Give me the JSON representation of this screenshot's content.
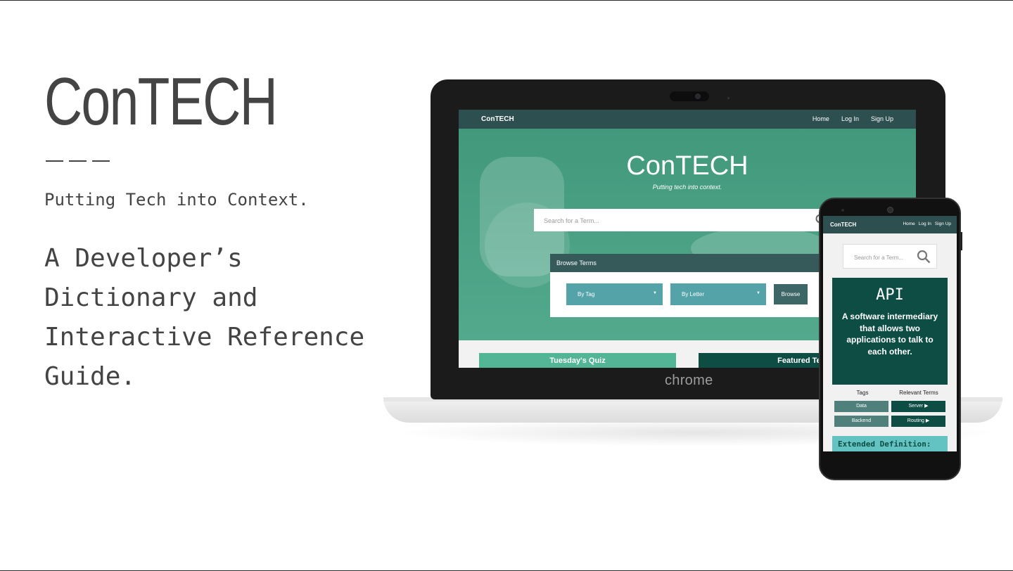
{
  "slide": {
    "brand": "ConTECH",
    "tagline": "Putting Tech into Context.",
    "headline": "A Developer’s Dictionary and Interactive Reference Guide."
  },
  "laptop": {
    "bezel_label": "chrome",
    "site": {
      "nav": {
        "brand": "ConTECH",
        "links": [
          "Home",
          "Log In",
          "Sign Up"
        ]
      },
      "hero": {
        "title": "ConTECH",
        "subtitle": "Putting tech into context."
      },
      "search": {
        "placeholder": "Search for a Term...",
        "icon": "search-icon"
      },
      "browse": {
        "title": "Browse Terms",
        "tag_select": "By Tag",
        "letter_select": "By Letter",
        "button": "Browse"
      },
      "sections": {
        "quiz": "Tuesday's Quiz",
        "featured": "Featured Ter"
      }
    }
  },
  "phone": {
    "nav": {
      "brand": "ConTECH",
      "links": [
        "Home",
        "Log In",
        "Sign Up"
      ]
    },
    "search": {
      "placeholder": "Search for a Term...",
      "icon": "search-icon"
    },
    "term": {
      "name": "API",
      "definition": "A software intermediary that allows two applications to talk to each other."
    },
    "tags_label": "Tags",
    "relevant_label": "Relevant Terms",
    "tags": [
      "Data",
      "Backend"
    ],
    "relevant_terms": [
      "Server ▶",
      "Routing ▶"
    ],
    "extended_label": "Extended Definition:"
  },
  "colors": {
    "nav": "#2e4f4f",
    "accent_green": "#52b596",
    "dark_teal": "#0e4d44",
    "dropdown_teal": "#54a3a8"
  }
}
